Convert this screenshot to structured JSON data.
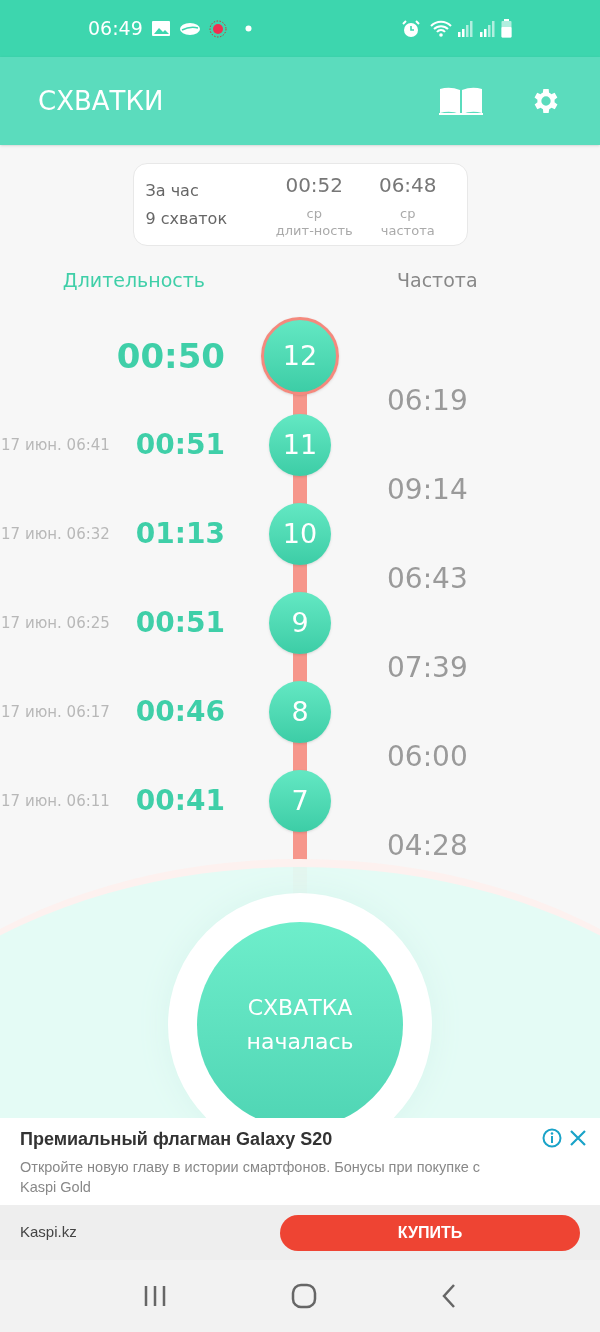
{
  "status_bar": {
    "time": "06:49"
  },
  "app_bar": {
    "title": "СХВАТКИ"
  },
  "summary": {
    "period": "За час",
    "count": "9 схваток",
    "stats": [
      {
        "value": "00:52",
        "label_1": "ср",
        "label_2": "длит-ность"
      },
      {
        "value": "06:48",
        "label_1": "ср",
        "label_2": "частота"
      }
    ]
  },
  "columns": [
    "Длительность",
    "Частота"
  ],
  "contractions": [
    {
      "number": "12",
      "duration": "00:50",
      "interval": "06:19",
      "selected": true
    },
    {
      "number": "11",
      "date": "17 июн. 06:41",
      "duration": "00:51",
      "interval": "09:14",
      "selected": false
    },
    {
      "number": "10",
      "date": "17 июн. 06:32",
      "duration": "01:13",
      "interval": "06:43",
      "selected": false
    },
    {
      "number": "9",
      "date": "17 июн. 06:25",
      "duration": "00:51",
      "interval": "07:39",
      "selected": false
    },
    {
      "number": "8",
      "date": "17 июн. 06:17",
      "duration": "00:46",
      "interval": "06:00",
      "selected": false
    },
    {
      "number": "7",
      "date": "17 июн. 06:11",
      "duration": "00:41",
      "interval": "04:28",
      "selected": false
    }
  ],
  "main_button": {
    "lines": [
      "СХВАТКА",
      "началась"
    ]
  },
  "ad": {
    "title": "Премиальный флагман Galaxy S20",
    "text": "Откройте новую главу в истории смартфонов. Бонусы при покупке с Kaspi Gold",
    "source": "Kaspi.kz",
    "button": "КУПИТЬ"
  }
}
